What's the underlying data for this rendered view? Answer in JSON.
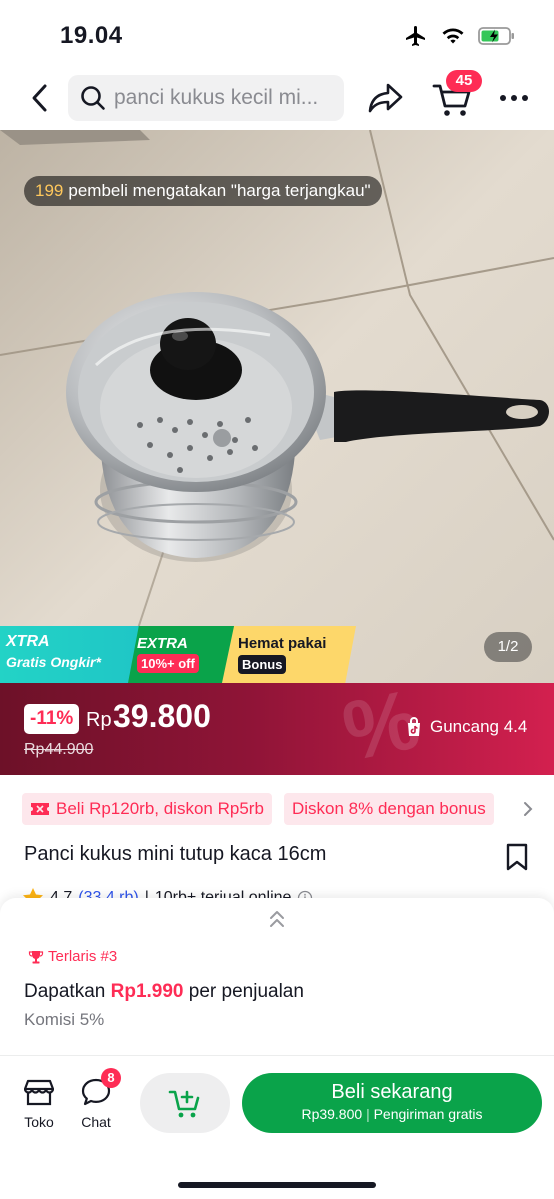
{
  "status_bar": {
    "time": "19.04",
    "icons": [
      "airplane-icon",
      "wifi-icon",
      "battery-charging-icon"
    ]
  },
  "header": {
    "search_placeholder": "panci kukus kecil mi...",
    "cart_count": "45"
  },
  "image": {
    "review_count": "199",
    "review_text": "pembeli mengatakan \"harga terjangkau\"",
    "counter": "1/2",
    "promos": {
      "xtra_title": "XTRA",
      "xtra_sub": "Gratis Ongkir*",
      "extra_title": "EXTRA",
      "extra_badge": "10%+ off",
      "hemat_title": "Hemat pakai",
      "hemat_badge": "Bonus"
    }
  },
  "price": {
    "discount": "-11%",
    "currency": "Rp",
    "value": "39.800",
    "original": "Rp44.900",
    "watermark": "%",
    "shake_label": "Guncang 4.4"
  },
  "chips": {
    "chip1": "Beli Rp120rb, diskon Rp5rb",
    "chip2": "Diskon 8% dengan bonus"
  },
  "product": {
    "title": "Panci kukus mini tutup kaca 16cm",
    "rating": "4.7",
    "rating_count": "(33,4 rb)",
    "separator": "|",
    "sold": "10rb+ terjual online"
  },
  "sheet": {
    "bestseller": "Terlaris #3",
    "earn_prefix": "Dapatkan",
    "earn_amount": "Rp1.990",
    "earn_suffix": "per penjualan",
    "commission": "Komisi 5%"
  },
  "actions": {
    "toko_label": "Toko",
    "chat_label": "Chat",
    "chat_badge": "8",
    "buy_title": "Beli sekarang",
    "buy_price": "Rp39.800",
    "buy_divider": "|",
    "buy_shipping": "Pengiriman gratis"
  },
  "colors": {
    "brand_red": "#fe2c55",
    "buy_green": "#0aa34a",
    "price_bar_dark": "#6d1128",
    "price_bar_light": "#d3204f"
  }
}
